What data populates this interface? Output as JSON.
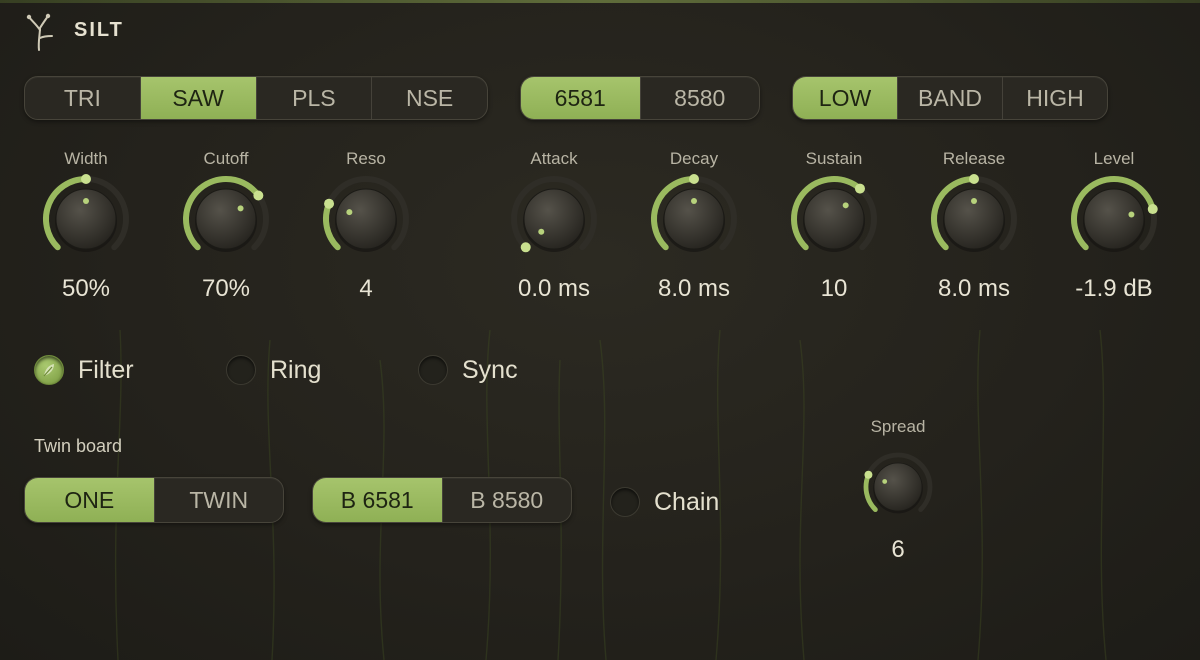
{
  "brand": {
    "name": "SILT"
  },
  "colors": {
    "accent": "#9aba5f",
    "background": "#25231d",
    "knob_track": "#2f2d27"
  },
  "waveform": {
    "options": [
      "TRI",
      "SAW",
      "PLS",
      "NSE"
    ],
    "selected": "SAW"
  },
  "chip": {
    "options": [
      "6581",
      "8580"
    ],
    "selected": "6581"
  },
  "filter_mode": {
    "options": [
      "LOW",
      "BAND",
      "HIGH"
    ],
    "selected": "LOW"
  },
  "knobs": [
    {
      "id": "width",
      "label": "Width",
      "value": "50%",
      "fraction": 0.5
    },
    {
      "id": "cutoff",
      "label": "Cutoff",
      "value": "70%",
      "fraction": 0.7
    },
    {
      "id": "reso",
      "label": "Reso",
      "value": "4",
      "fraction": 0.25
    },
    {
      "id": "attack",
      "label": "Attack",
      "value": "0.0 ms",
      "fraction": 0.0
    },
    {
      "id": "decay",
      "label": "Decay",
      "value": "8.0 ms",
      "fraction": 0.5
    },
    {
      "id": "sustain",
      "label": "Sustain",
      "value": "10",
      "fraction": 0.65
    },
    {
      "id": "release",
      "label": "Release",
      "value": "8.0 ms",
      "fraction": 0.5
    },
    {
      "id": "level",
      "label": "Level",
      "value": "-1.9 dB",
      "fraction": 0.78
    }
  ],
  "toggles": {
    "filter": {
      "label": "Filter",
      "on": true
    },
    "ring": {
      "label": "Ring",
      "on": false
    },
    "sync": {
      "label": "Sync",
      "on": false
    },
    "chain": {
      "label": "Chain",
      "on": false
    }
  },
  "twin_board": {
    "label": "Twin board",
    "mode": {
      "options": [
        "ONE",
        "TWIN"
      ],
      "selected": "ONE"
    },
    "board_chip": {
      "options": [
        "B 6581",
        "B 8580"
      ],
      "selected": "B 6581"
    }
  },
  "spread": {
    "label": "Spread",
    "value": "6",
    "fraction": 0.25
  }
}
